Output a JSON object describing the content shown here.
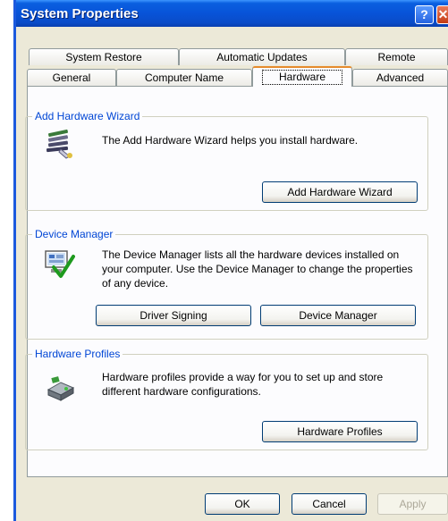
{
  "window": {
    "title": "System Properties",
    "help_glyph": "?",
    "close_glyph": "✕"
  },
  "tabs": {
    "row1": [
      "System Restore",
      "Automatic Updates",
      "Remote"
    ],
    "row2": [
      "General",
      "Computer Name",
      "Hardware",
      "Advanced"
    ],
    "active": "Hardware"
  },
  "hardware_wizard": {
    "title": "Add Hardware Wizard",
    "description": "The Add Hardware Wizard helps you install hardware.",
    "button_label": "Add Hardware Wizard",
    "icon": "hardware-wizard-icon"
  },
  "device_manager": {
    "title": "Device Manager",
    "description": "The Device Manager lists all the hardware devices installed on your computer. Use the Device Manager to change the properties of any device.",
    "driver_signing_label": "Driver Signing",
    "device_manager_label": "Device Manager",
    "icon": "device-manager-icon"
  },
  "hardware_profiles": {
    "title": "Hardware Profiles",
    "description": "Hardware profiles provide a way for you to set up and store different hardware configurations.",
    "button_label": "Hardware Profiles",
    "icon": "hardware-profiles-icon"
  },
  "footer": {
    "ok_label": "OK",
    "cancel_label": "Cancel",
    "apply_label": "Apply"
  },
  "colors": {
    "title_bar": "#0a5fe0",
    "group_title": "#0046d5",
    "tab_highlight": "#e68b2c"
  }
}
